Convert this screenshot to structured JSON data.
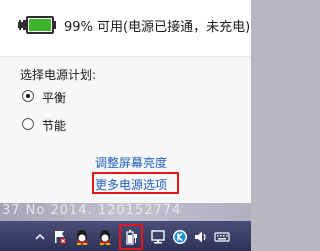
{
  "battery": {
    "percent": 99,
    "status_text": "99% 可用(电源已接通，未充电)",
    "icon": "battery-plugged-icon",
    "colors": {
      "fill": "#3db52b",
      "plug": "#2e2e2e"
    }
  },
  "power_plan": {
    "title": "选择电源计划:",
    "options": [
      {
        "label": "平衡",
        "selected": true
      },
      {
        "label": "节能",
        "selected": false
      }
    ]
  },
  "links": {
    "adjust_brightness": "调整屏幕亮度",
    "more_power_options": "更多电源选项"
  },
  "highlight_color": "#e01818",
  "desktop": {
    "text": "37 No 2014. 120152774"
  },
  "taskbar": {
    "tray_icons": [
      "show-hidden-icons-chevron-icon",
      "flag-action-center-icon",
      "qq-icon",
      "qq-icon",
      "power-battery-icon",
      "network-icon",
      "k-app-icon",
      "volume-icon",
      "keyboard-icon"
    ]
  }
}
